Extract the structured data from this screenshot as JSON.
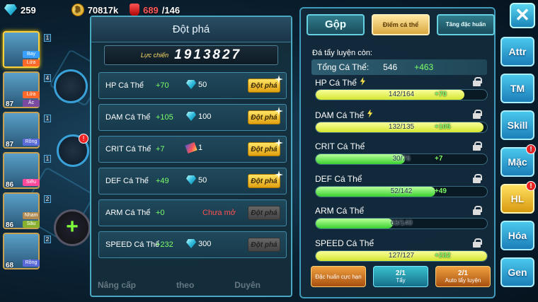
{
  "resources": {
    "gems": "259",
    "gold": "70817k",
    "stamina_current": "689",
    "stamina_max": "/146"
  },
  "party": [
    {
      "level": "",
      "types": [
        "Bay",
        "Lửa"
      ],
      "type_colors": [
        "#3aa0ff",
        "#ff6a2a"
      ],
      "slot": "1"
    },
    {
      "level": "87",
      "types": [
        "Lửa",
        "Ác"
      ],
      "type_colors": [
        "#ff6a2a",
        "#7a4aa0"
      ],
      "slot": "4"
    },
    {
      "level": "87",
      "types": [
        "Rồng"
      ],
      "type_colors": [
        "#5a6ad8"
      ],
      "slot": "1"
    },
    {
      "level": "86",
      "types": [
        "Siêu"
      ],
      "type_colors": [
        "#ff4a9a"
      ],
      "slot": "1"
    },
    {
      "level": "86",
      "types": [
        "Nham",
        "Sâu"
      ],
      "type_colors": [
        "#b08a50",
        "#8ab030"
      ],
      "slot": "2"
    },
    {
      "level": "68",
      "types": [
        "Rồng"
      ],
      "type_colors": [
        "#5a6ad8"
      ],
      "slot": "2"
    }
  ],
  "panel": {
    "title": "Đột phá",
    "power_label": "Lực chiến",
    "power_value": "1913827",
    "rows": [
      {
        "label": "HP Cá Thể",
        "plus": "+70",
        "cost_icon": "gem-icon",
        "cost": "50",
        "button": "Đột phá",
        "enabled": true
      },
      {
        "label": "DAM Cá Thể",
        "plus": "+105",
        "cost_icon": "gem-icon",
        "cost": "100",
        "button": "Đột phá",
        "enabled": true
      },
      {
        "label": "CRIT Cá Thể",
        "plus": "+7",
        "cost_icon": "scroll-icon",
        "cost": "1",
        "button": "Đột phá",
        "enabled": true
      },
      {
        "label": "DEF Cá Thể",
        "plus": "+49",
        "cost_icon": "gem-icon",
        "cost": "50",
        "button": "Đột phá",
        "enabled": true
      },
      {
        "label": "ARM Cá Thể",
        "plus": "+0",
        "locked_text": "Chưa mở",
        "button": "Đột phá",
        "enabled": false
      },
      {
        "label": "SPEED Cá Thể",
        "plus": "+232",
        "cost_icon": "gem-icon",
        "cost": "300",
        "button": "Đột phá",
        "enabled": false
      }
    ],
    "bottom_nav": [
      "Nâng cấp",
      "theo",
      "Duyên"
    ]
  },
  "right": {
    "tabs": [
      "Gộp",
      "Điểm cá thể",
      "Tăng đặc huấn"
    ],
    "remain_label": "Đá tẩy luyện còn:",
    "total_label": "Tổng Cá Thể:",
    "total_value": "546",
    "total_plus": "+463",
    "stats": [
      {
        "name": "HP Cá Thể",
        "text": "142/164",
        "plus": "+70",
        "fill": 0.866,
        "style": "y",
        "bolt": true
      },
      {
        "name": "DAM Cá Thể",
        "text": "132/135",
        "plus": "+105",
        "fill": 0.978,
        "style": "y",
        "bolt": true
      },
      {
        "name": "CRIT Cá Thể",
        "text": "30/76",
        "plus": "+7",
        "fill": 0.52,
        "style": "g",
        "bolt": false
      },
      {
        "name": "DEF Cá Thể",
        "text": "52/142",
        "plus": "+49",
        "fill": 0.7,
        "style": "g",
        "bolt": false
      },
      {
        "name": "ARM Cá Thể",
        "text": "63/140",
        "plus": "",
        "fill": 0.45,
        "style": "g",
        "bolt": false
      },
      {
        "name": "SPEED Cá Thể",
        "text": "127/127",
        "plus": "+232",
        "fill": 1.0,
        "style": "y",
        "bolt": false
      }
    ],
    "buttons": [
      {
        "label": "Đặc huấn cực hạn",
        "count": ""
      },
      {
        "label": "Tẩy",
        "count": "2/1"
      },
      {
        "label": "Auto tẩy luyện",
        "count": "2/1"
      }
    ]
  },
  "side_nav": [
    {
      "label": "Attr",
      "highlight": false,
      "badge": ""
    },
    {
      "label": "TM",
      "highlight": false,
      "badge": ""
    },
    {
      "label": "Skill",
      "highlight": false,
      "badge": ""
    },
    {
      "label": "Mặc",
      "highlight": false,
      "badge": "!"
    },
    {
      "label": "HL",
      "highlight": true,
      "badge": "!"
    },
    {
      "label": "Hóa",
      "highlight": false,
      "badge": ""
    },
    {
      "label": "Gen",
      "highlight": false,
      "badge": ""
    }
  ],
  "close_label": "✕"
}
